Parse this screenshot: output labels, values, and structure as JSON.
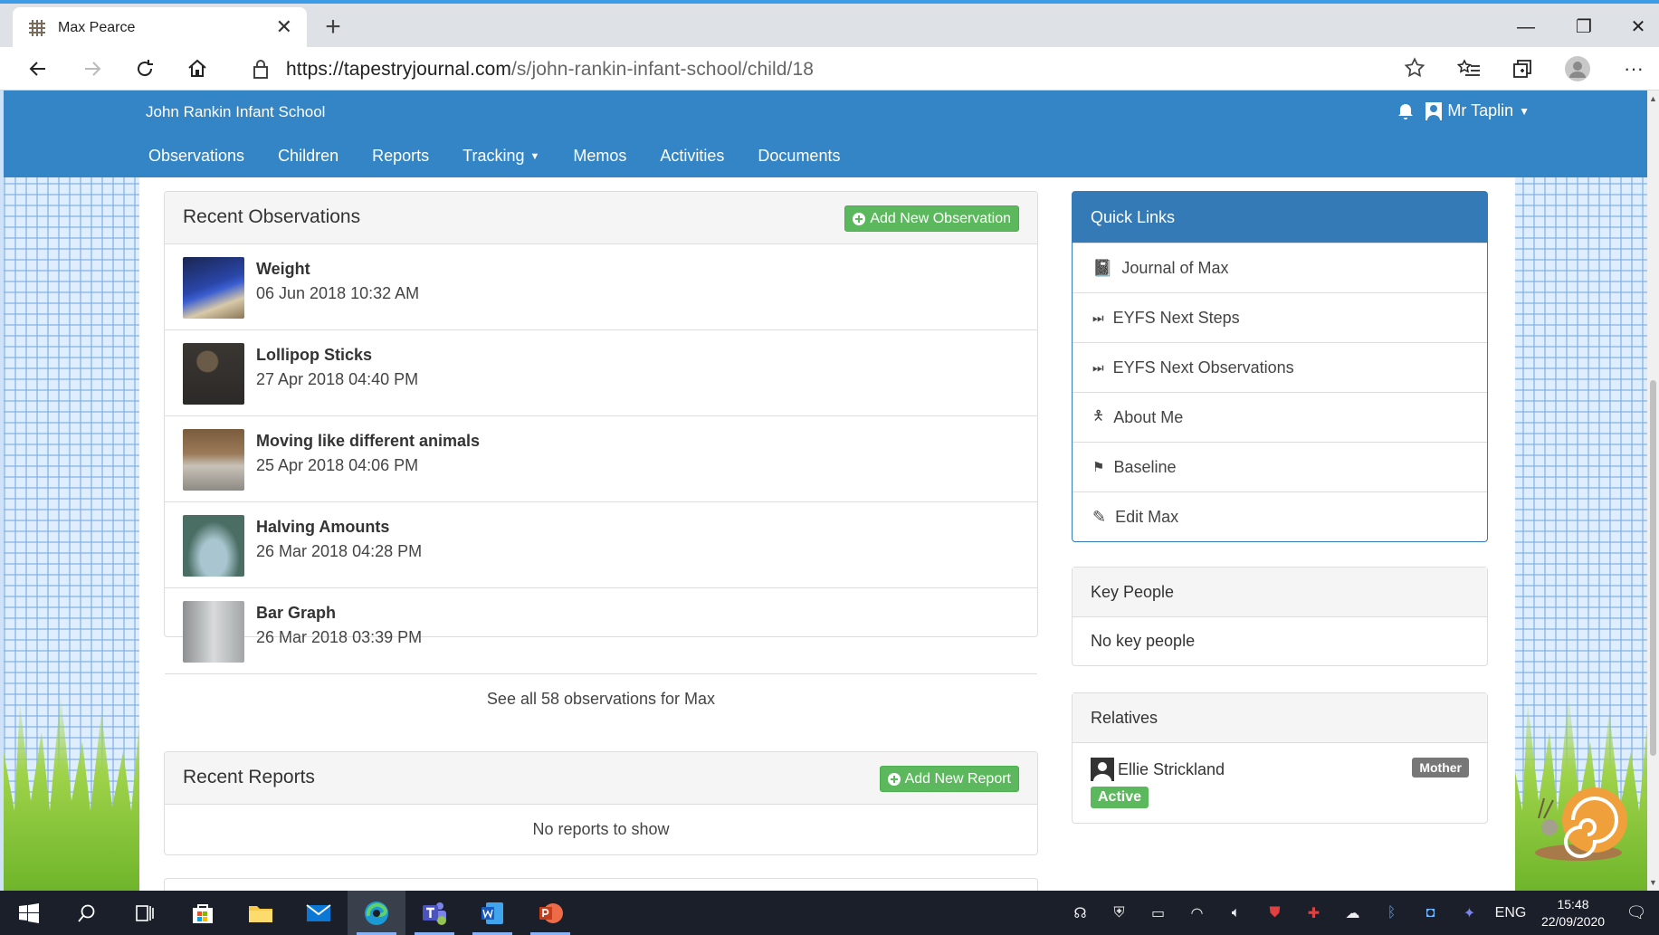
{
  "browser": {
    "tab_title": "Max Pearce",
    "url_host": "https://tapestryjournal.com",
    "url_path": "/s/john-rankin-infant-school/child/18"
  },
  "site": {
    "school_name": "John Rankin Infant School",
    "user_name": "Mr Taplin",
    "nav": [
      "Observations",
      "Children",
      "Reports",
      "Tracking",
      "Memos",
      "Activities",
      "Documents"
    ]
  },
  "observations": {
    "title": "Recent Observations",
    "add_label": "Add New Observation",
    "items": [
      {
        "title": "Weight",
        "date": "06 Jun 2018 10:32 AM"
      },
      {
        "title": "Lollipop Sticks",
        "date": "27 Apr 2018 04:40 PM"
      },
      {
        "title": "Moving like different animals",
        "date": "25 Apr 2018 04:06 PM"
      },
      {
        "title": "Halving Amounts",
        "date": "26 Mar 2018 04:28 PM"
      },
      {
        "title": "Bar Graph",
        "date": "26 Mar 2018 03:39 PM"
      }
    ],
    "see_all": "See all 58 observations for Max"
  },
  "reports": {
    "title": "Recent Reports",
    "add_label": "Add New Report",
    "empty": "No reports to show"
  },
  "quick_links": {
    "title": "Quick Links",
    "items": [
      "Journal of Max",
      "EYFS Next Steps",
      "EYFS Next Observations",
      "About Me",
      "Baseline",
      "Edit Max"
    ]
  },
  "key_people": {
    "title": "Key People",
    "empty": "No key people"
  },
  "relatives": {
    "title": "Relatives",
    "name": "Ellie Strickland",
    "relation": "Mother",
    "status": "Active"
  },
  "taskbar": {
    "lang": "ENG",
    "time": "15:48",
    "date": "22/09/2020"
  }
}
